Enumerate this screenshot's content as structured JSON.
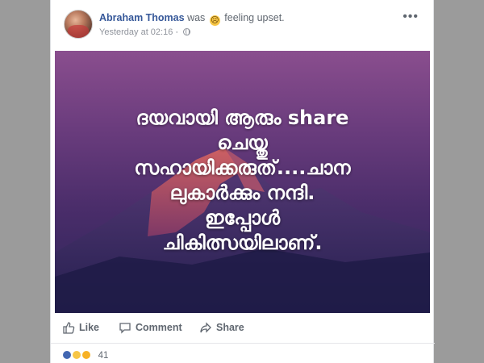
{
  "post": {
    "author": "Abraham Thomas",
    "activity_prefix": "was",
    "feeling": "feeling upset.",
    "timestamp": "Yesterday at 02:16",
    "more_icon": "more-options-icon",
    "image_text_lines": [
      "ദയവായി ആരും share",
      "ചെയ്തു",
      "സഹായിക്കരുത്....ചാന",
      "ലുകാർക്കും നന്ദി.",
      "ഇപ്പോൾ",
      "ചികിത്സയിലാണ്."
    ]
  },
  "actions": {
    "like": "Like",
    "comment": "Comment",
    "share": "Share"
  },
  "reactions": {
    "count": "41",
    "icons": [
      "like-reaction-icon",
      "sad-reaction-icon",
      "haha-reaction-icon"
    ]
  },
  "colors": {
    "author": "#365899",
    "image_top": "#8a4e8e",
    "image_bottom": "#2c2459"
  }
}
